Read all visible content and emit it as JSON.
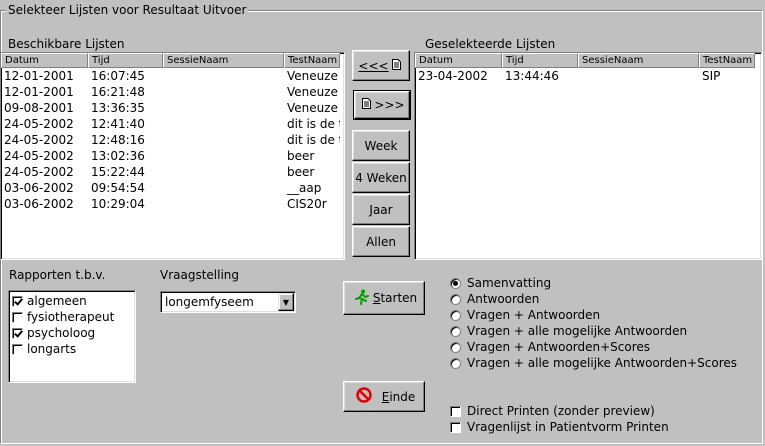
{
  "window": {
    "group_title": "Selekteer Lijsten voor Resultaat Uitvoer"
  },
  "available": {
    "label": "Beschikbare Lijsten",
    "columns": [
      "Datum",
      "Tijd",
      "SessieNaam",
      "TestNaam"
    ],
    "rows": [
      [
        "12-01-2001",
        "16:07:45",
        "",
        "Veneuze Vaat"
      ],
      [
        "12-01-2001",
        "16:21:48",
        "",
        "Veneuze Vaat"
      ],
      [
        "09-08-2001",
        "13:36:35",
        "",
        "Veneuze Vaat"
      ],
      [
        "24-05-2002",
        "12:41:40",
        "",
        "dit is de titel"
      ],
      [
        "24-05-2002",
        "12:48:16",
        "",
        "dit is de titel"
      ],
      [
        "24-05-2002",
        "13:02:36",
        "",
        "beer"
      ],
      [
        "24-05-2002",
        "15:22:44",
        "",
        "beer"
      ],
      [
        "03-06-2002",
        "09:54:54",
        "",
        "__aap"
      ],
      [
        "03-06-2002",
        "10:29:04",
        "",
        "CIS20r"
      ]
    ]
  },
  "selected": {
    "label": "Geselekteerde Lijsten",
    "columns": [
      "Datum",
      "Tijd",
      "SessieNaam",
      "TestNaam"
    ],
    "rows": [
      [
        "23-04-2002",
        "13:44:46",
        "",
        "SIP"
      ]
    ]
  },
  "transfer": {
    "remove_label": "<<<",
    "add_label": ">>>",
    "week_label": "Week",
    "four_weeks_label": "4 Weken",
    "year_label": "Jaar",
    "all_label": "Allen"
  },
  "reports": {
    "label": "Rapporten t.b.v.",
    "items": [
      {
        "label": "algemeen",
        "checked": true
      },
      {
        "label": "fysiotherapeut",
        "checked": false
      },
      {
        "label": "psycholoog",
        "checked": true
      },
      {
        "label": "longarts",
        "checked": false
      }
    ]
  },
  "question": {
    "label": "Vraagstelling",
    "value": "longemfyseem"
  },
  "actions": {
    "start_first": "S",
    "start_rest": "tarten",
    "end_first": "E",
    "end_rest": "inde"
  },
  "output": {
    "options": [
      {
        "label": "Samenvatting",
        "selected": true
      },
      {
        "label": "Antwoorden",
        "selected": false
      },
      {
        "label": "Vragen + Antwoorden",
        "selected": false
      },
      {
        "label": "Vragen + alle mogelijke Antwoorden",
        "selected": false
      },
      {
        "label": "Vragen + Antwoorden+Scores",
        "selected": false
      },
      {
        "label": "Vragen + alle mogelijke Antwoorden+Scores",
        "selected": false
      }
    ],
    "checkboxes": [
      {
        "label": "Direct Printen (zonder preview)",
        "checked": false
      },
      {
        "label": "Vragenlijst in Patientvorm Printen",
        "checked": false
      }
    ]
  },
  "colors": {
    "face": "#c0c0c0",
    "window": "#ffffff",
    "start_icon": "#00a000",
    "end_icon": "#e00000"
  }
}
